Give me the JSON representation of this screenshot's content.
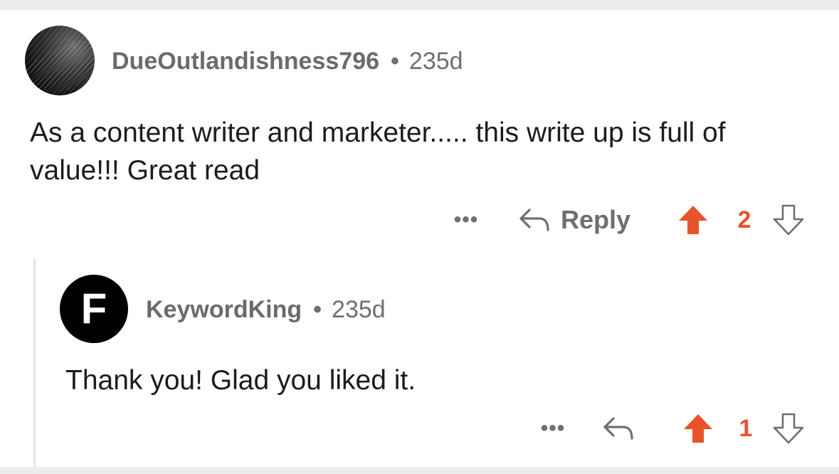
{
  "comment": {
    "author": "DueOutlandishness796",
    "separator": "•",
    "age": "235d",
    "body": "As a content writer and marketer..... this write up is full of value!!! Great read",
    "actions": {
      "more_label": "•••",
      "reply_label": "Reply",
      "score": "2"
    }
  },
  "reply": {
    "avatar_letter": "F",
    "author": "KeywordKing",
    "separator": "•",
    "age": "235d",
    "body": "Thank you! Glad you liked it.",
    "actions": {
      "more_label": "•••",
      "score": "1"
    }
  },
  "colors": {
    "upvote_active": "#e8532b",
    "muted_text": "#6f6f72",
    "body_text": "#1c1c1e",
    "background_band": "#ececee"
  },
  "icons": {
    "upvote": "arrow-up-icon",
    "downvote": "arrow-down-icon",
    "reply": "reply-arrow-icon",
    "more": "more-dots-icon"
  }
}
